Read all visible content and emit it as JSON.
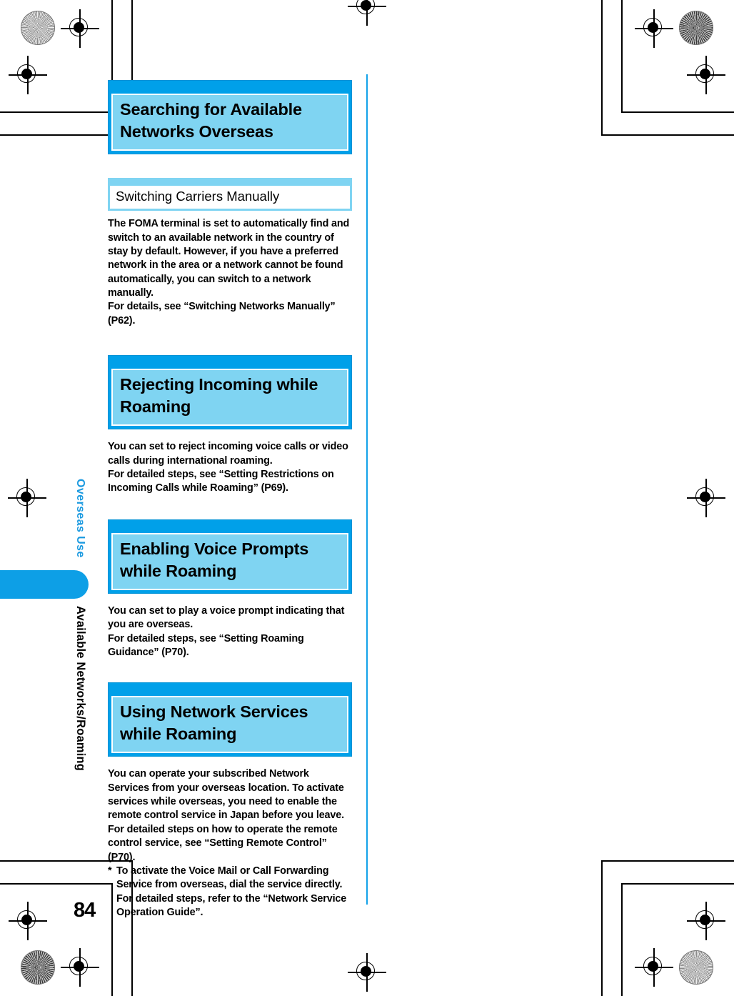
{
  "page": {
    "number": "84",
    "sidebar": {
      "chapter": "Overseas Use",
      "section": "Available Networks/Roaming"
    }
  },
  "sections": [
    {
      "heading": "Searching for Available Networks Overseas",
      "subheading": "Switching Carriers Manually",
      "paragraphs": [
        "The FOMA terminal is set to automatically find and switch to an available network in the country of stay by default. However, if you have a preferred network in the area or a network cannot be found automatically, you can switch to a network manually.",
        "For details, see “Switching Networks Manually” (P62)."
      ]
    },
    {
      "heading": "Rejecting Incoming while Roaming",
      "paragraphs": [
        "You can set to reject incoming voice calls or video calls during international roaming.",
        "For detailed steps, see “Setting Restrictions on Incoming Calls while Roaming” (P69)."
      ]
    },
    {
      "heading": "Enabling Voice Prompts while Roaming",
      "paragraphs": [
        "You can set to play a voice prompt indicating that you are overseas.",
        "For detailed steps, see “Setting Roaming Guidance” (P70)."
      ]
    },
    {
      "heading": "Using Network Services while Roaming",
      "paragraphs": [
        "You can operate your subscribed Network Services from your overseas location. To activate services while overseas, you need to enable the remote control service in Japan before you leave.",
        "For detailed steps on how to operate the remote control service, see “Setting Remote Control” (P70)."
      ],
      "note_marker": "*",
      "note": "To activate the Voice Mail or Call Forwarding Service from overseas, dial the service directly. For detailed steps, refer to the “Network Service Operation Guide”."
    }
  ],
  "colors": {
    "header_bar": "#00a0e9",
    "header_fill": "#7fd4f2",
    "rule": "#12a2e8",
    "sidebar_chapter": "#1b9ae0",
    "sidebar_tab": "#0d9fe6"
  }
}
